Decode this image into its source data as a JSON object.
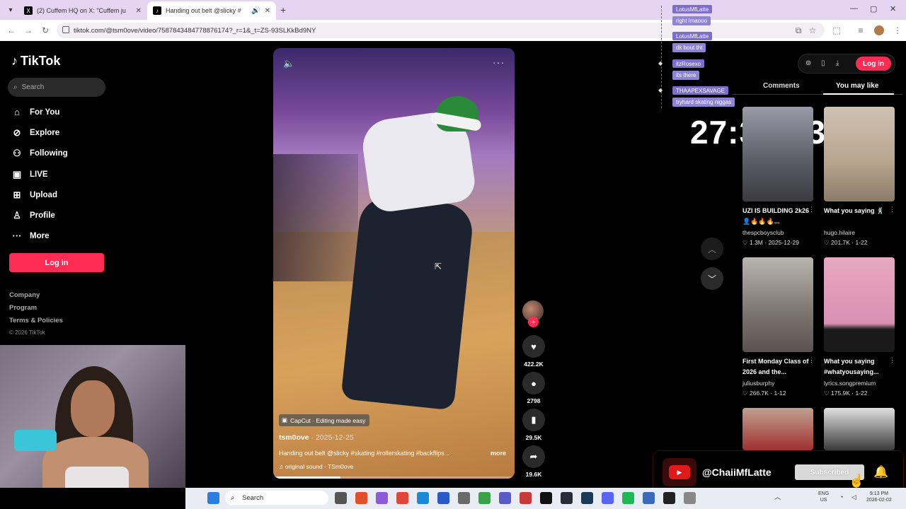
{
  "browser": {
    "tabs": [
      {
        "title": "(2) Cuffem HQ on X: \"Cuffem ju"
      },
      {
        "title": "Handing out belt @slicky #"
      }
    ],
    "url": "tiktok.com/@tsm0ove/video/7587843484778876174?_r=1&_t=ZS-93SLKkBd9NY"
  },
  "sidebar": {
    "brand": "TikTok",
    "search_placeholder": "Search",
    "nav": [
      {
        "label": "For You",
        "icon": "home-icon"
      },
      {
        "label": "Explore",
        "icon": "compass-icon"
      },
      {
        "label": "Following",
        "icon": "following-icon"
      },
      {
        "label": "LIVE",
        "icon": "live-icon"
      },
      {
        "label": "Upload",
        "icon": "upload-icon"
      },
      {
        "label": "Profile",
        "icon": "profile-icon"
      },
      {
        "label": "More",
        "icon": "more-icon"
      }
    ],
    "login_label": "Log in",
    "footer": [
      "Company",
      "Program",
      "Terms & Policies"
    ],
    "copyright": "© 2026 TikTok"
  },
  "video": {
    "capcut": "CapCut · Editing made easy",
    "author": "tsm0ove",
    "date": "2025-12-25",
    "caption": "Handing out belt @slicky #skating #rollerskating #backflips ...",
    "more": "more",
    "sound": "original sound - TSm0ove",
    "progress": 0.28
  },
  "actions": {
    "likes": "422.2K",
    "comments": "2798",
    "saves": "29.5K",
    "shares": "19.6K"
  },
  "chat": [
    {
      "name": "LotusMfLatte",
      "msg": "right lmaooo"
    },
    {
      "name": "LotusMfLatte",
      "msg": "dk bout tht"
    },
    {
      "name": "itzRosexo",
      "msg": "its there"
    },
    {
      "name": "THAAPEXSAVAGE",
      "msg": "tryhard skating niggas"
    }
  ],
  "timer": "27:39:13",
  "right_panel": {
    "login": "Log in",
    "tabs": [
      "Comments",
      "You may like"
    ],
    "cards": [
      {
        "title": "UZI IS BUILDING 2k26👤🔥🔥🔥...",
        "user": "thespcboysclub",
        "likes": "1.3M",
        "date": "2025-12-29"
      },
      {
        "title": "What you saying 🕺",
        "user": "hugo.hilaire",
        "likes": "201.7K",
        "date": "1-22"
      },
      {
        "title": "First Monday Class of 2026 and the...",
        "user": "juliusburphy",
        "likes": "266.7K",
        "date": "1-12"
      },
      {
        "title": "What you saying #whatyousaying...",
        "user": "lyrics.songpremium",
        "likes": "175.9K",
        "date": "1-22"
      }
    ]
  },
  "subscribe": {
    "handle": "@ChaiiMfLatte",
    "button": "Subscribed"
  },
  "taskbar": {
    "search": "Search",
    "lang": "ENG",
    "region": "US",
    "time": "9:13 PM",
    "date": "2026-02-02"
  },
  "colors": {
    "brand": "#fe2c55",
    "chat_name": "#7d6fc9",
    "chat_msg": "#8f83d6",
    "youtube": "#e01a1a"
  }
}
